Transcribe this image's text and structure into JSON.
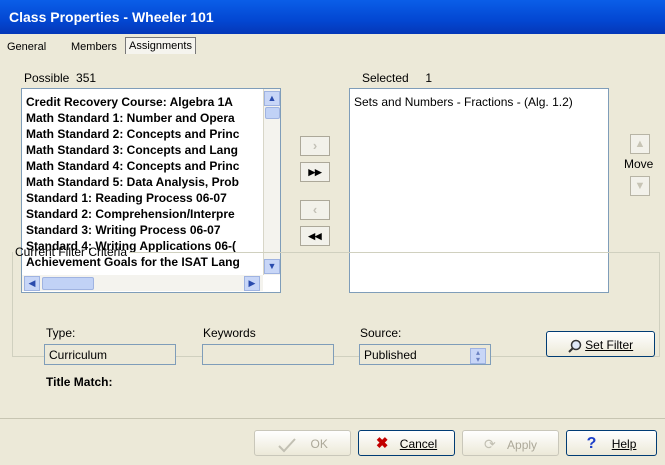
{
  "window": {
    "title": "Class Properties - Wheeler 101"
  },
  "tabs": [
    {
      "label": "General"
    },
    {
      "label": "Members"
    },
    {
      "label": "Assignments",
      "active": true
    }
  ],
  "possible": {
    "label": "Possible",
    "count": "351",
    "items": [
      "Credit Recovery Course: Algebra 1A",
      "Math Standard 1: Number and Opera",
      "Math Standard 2: Concepts and Princ",
      "Math Standard 3: Concepts and Lang",
      "Math Standard 4: Concepts and Princ",
      "Math Standard 5: Data Analysis, Prob",
      "Standard 1: Reading Process 06-07",
      "Standard 2: Comprehension/Interpre",
      "Standard 3: Writing Process 06-07",
      "Standard 4: Writing Applications 06-(",
      "Achievement Goals for the ISAT Lang"
    ]
  },
  "selected": {
    "label": "Selected",
    "count": "1",
    "items": [
      "Sets and Numbers - Fractions - (Alg. 1.2)"
    ]
  },
  "move": {
    "label": "Move"
  },
  "filter": {
    "legend": "Current Filter Criteria",
    "type_label": "Type:",
    "type_value": "Curriculum",
    "keywords_label": "Keywords",
    "keywords_value": "",
    "source_label": "Source:",
    "source_value": "Published",
    "title_match_label": "Title Match:",
    "set_filter_label": "Set Filter"
  },
  "buttons": {
    "ok": "OK",
    "cancel": "Cancel",
    "apply": "Apply",
    "help": "Help"
  }
}
